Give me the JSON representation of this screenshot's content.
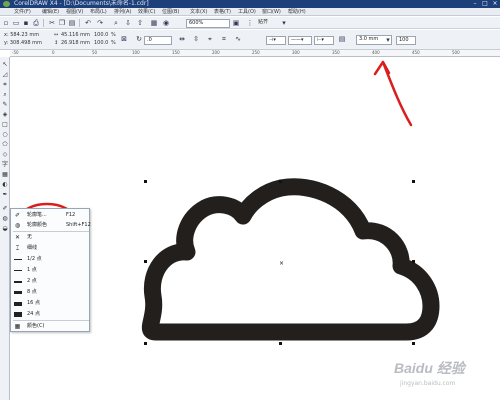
{
  "window": {
    "title": "CorelDRAW X4 - [D:\\Documents\\未命名-1.cdr]"
  },
  "menu": [
    "文件(F)",
    "编辑(E)",
    "视图(V)",
    "布局(L)",
    "排列(A)",
    "效果(C)",
    "位图(B)",
    "文本(X)",
    "表格(T)",
    "工具(O)",
    "窗口(W)",
    "帮助(H)"
  ],
  "toolbar": {
    "zoom": "600%",
    "snap": "贴齐"
  },
  "properties": {
    "x": "x: 584.23 mm",
    "y": "y: 308.498 mm",
    "w": "45.116 mm",
    "h": "26.918 mm",
    "scale_x": "100.0",
    "scale_y": "100.0",
    "pct": "%",
    "angle": ".0",
    "outline_width": "3.0 mm",
    "misc": "100"
  },
  "ruler_ticks": [
    "-50",
    "0",
    "50",
    "100",
    "150",
    "200",
    "250",
    "300",
    "350",
    "400",
    "450",
    "500"
  ],
  "outline_flyout": {
    "pen": "轮廓笔...",
    "pen_key": "F12",
    "color": "轮廓颜色",
    "color_key": "Shift+F12",
    "widths": [
      "无",
      "细线",
      "1/2 点",
      "1 点",
      "2 点",
      "8 点",
      "16 点",
      "24 点"
    ],
    "color_window": "颜色(C)"
  },
  "watermark": {
    "brand": "Baidu 经验",
    "url": "jingyan.baidu.com"
  },
  "colors": {
    "annotation": "#d81e1e",
    "cloud": "#231f1c",
    "titlebar": "#1d3f7a"
  }
}
